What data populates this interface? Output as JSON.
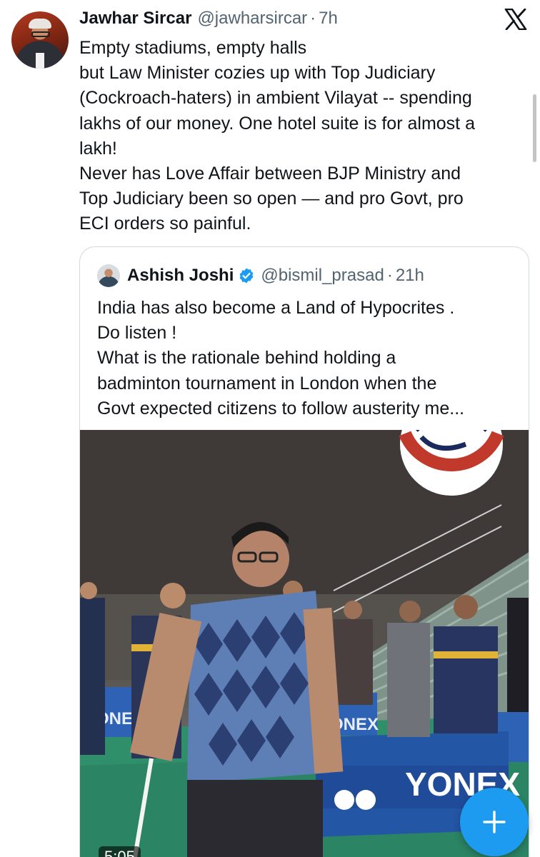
{
  "tweet": {
    "author_name": "Jawhar Sircar",
    "author_handle": "@jawharsircar",
    "separator": "·",
    "time": "7h",
    "lines": [
      "Empty stadiums, empty halls",
      "but Law Minister cozies up with Top Judiciary",
      "(Cockroach-haters) in ambient Vilayat -- spending",
      "lakhs of our money. One hotel suite is for almost a",
      "lakh!",
      "Never has Love Affair between BJP Ministry  and",
      "Top Judiciary been so open — and pro Govt, pro",
      "ECI orders so painful."
    ]
  },
  "quote": {
    "author_name": "Ashish Joshi",
    "author_handle": "@bismil_prasad",
    "separator": "·",
    "time": "21h",
    "lines": [
      "India has  also become a Land of Hypocrites  .",
      "Do listen !",
      "What is the rationale behind holding a",
      "badminton tournament in London when the",
      "Govt expected citizens to follow austerity me..."
    ],
    "video": {
      "banner_text_left": "ONE",
      "banner_text_mid": "ONEX",
      "banner_text_right": "YONEX",
      "duration": "5:05"
    }
  },
  "icons": {
    "platform": "x-logo-icon",
    "verified": "verified-badge-icon",
    "compose": "plus-icon"
  },
  "colors": {
    "text": "#0f1419",
    "secondary": "#536471",
    "accent": "#1d9bf0",
    "border": "#cfd9de"
  }
}
